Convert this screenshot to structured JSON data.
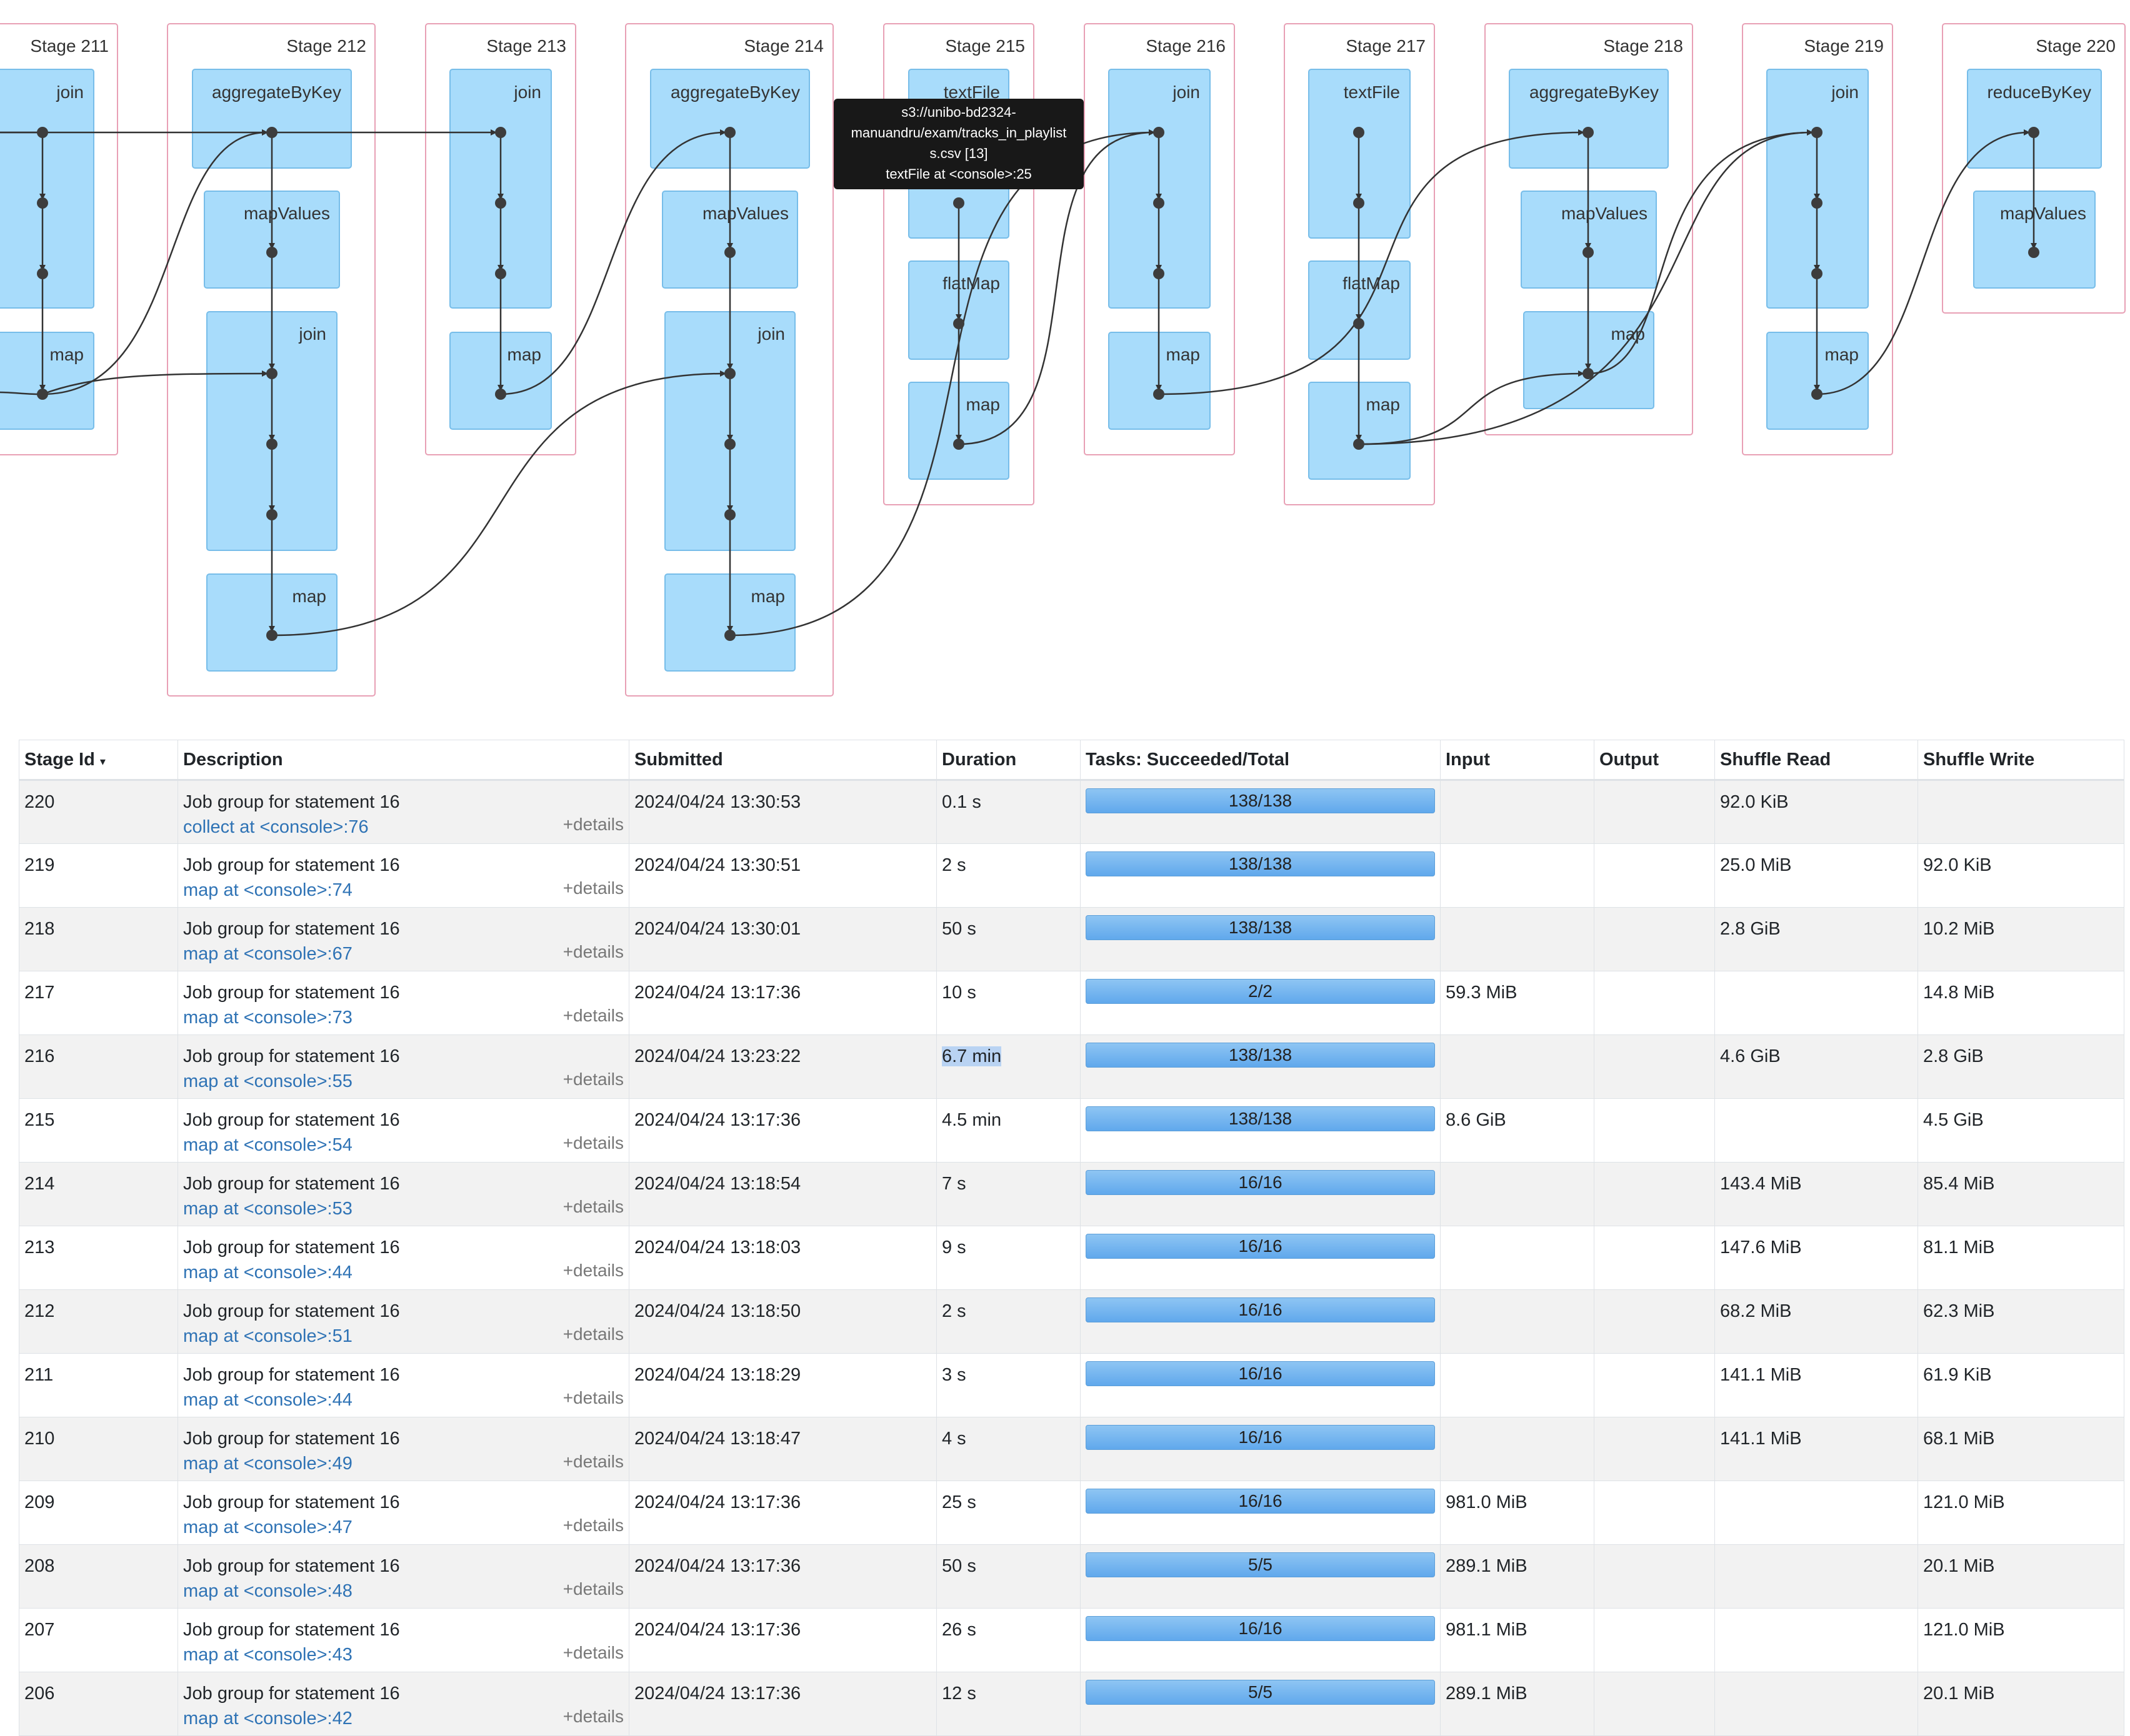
{
  "dag": {
    "stages": [
      {
        "title": "Stage 211",
        "ops": [
          "join",
          "map"
        ]
      },
      {
        "title": "Stage 212",
        "ops": [
          "aggregateByKey",
          "mapValues",
          "join",
          "map"
        ]
      },
      {
        "title": "Stage 213",
        "ops": [
          "join",
          "map"
        ]
      },
      {
        "title": "Stage 214",
        "ops": [
          "aggregateByKey",
          "mapValues",
          "join",
          "map"
        ]
      },
      {
        "title": "Stage 215",
        "ops": [
          "textFile",
          "flatMap",
          "map"
        ]
      },
      {
        "title": "Stage 216",
        "ops": [
          "join",
          "map"
        ]
      },
      {
        "title": "Stage 217",
        "ops": [
          "textFile",
          "flatMap",
          "map"
        ]
      },
      {
        "title": "Stage 218",
        "ops": [
          "aggregateByKey",
          "mapValues",
          "map"
        ]
      },
      {
        "title": "Stage 219",
        "ops": [
          "join",
          "map"
        ]
      },
      {
        "title": "Stage 220",
        "ops": [
          "reduceByKey",
          "mapValues"
        ]
      }
    ],
    "tooltip": {
      "lines": [
        "s3://unibo-bd2324-",
        "manuandru/exam/tracks_in_playlist",
        "s.csv [13]",
        "textFile at <console>:25"
      ]
    }
  },
  "table": {
    "headers": [
      "Stage Id",
      "Description",
      "Submitted",
      "Duration",
      "Tasks: Succeeded/Total",
      "Input",
      "Output",
      "Shuffle Read",
      "Shuffle Write"
    ],
    "sort_indicator": "▾",
    "details_label": "+details",
    "rows": [
      {
        "id": "220",
        "desc": "Job group for statement 16",
        "link": "collect at <console>:76",
        "submitted": "2024/04/24 13:30:53",
        "duration": "0.1 s",
        "tasks": "138/138",
        "input": "",
        "output": "",
        "shuffle_read": "92.0 KiB",
        "shuffle_write": ""
      },
      {
        "id": "219",
        "desc": "Job group for statement 16",
        "link": "map at <console>:74",
        "submitted": "2024/04/24 13:30:51",
        "duration": "2 s",
        "tasks": "138/138",
        "input": "",
        "output": "",
        "shuffle_read": "25.0 MiB",
        "shuffle_write": "92.0 KiB"
      },
      {
        "id": "218",
        "desc": "Job group for statement 16",
        "link": "map at <console>:67",
        "submitted": "2024/04/24 13:30:01",
        "duration": "50 s",
        "tasks": "138/138",
        "input": "",
        "output": "",
        "shuffle_read": "2.8 GiB",
        "shuffle_write": "10.2 MiB"
      },
      {
        "id": "217",
        "desc": "Job group for statement 16",
        "link": "map at <console>:73",
        "submitted": "2024/04/24 13:17:36",
        "duration": "10 s",
        "tasks": "2/2",
        "input": "59.3 MiB",
        "output": "",
        "shuffle_read": "",
        "shuffle_write": "14.8 MiB"
      },
      {
        "id": "216",
        "desc": "Job group for statement 16",
        "link": "map at <console>:55",
        "submitted": "2024/04/24 13:23:22",
        "duration": "6.7 min",
        "tasks": "138/138",
        "input": "",
        "output": "",
        "shuffle_read": "4.6 GiB",
        "shuffle_write": "2.8 GiB"
      },
      {
        "id": "215",
        "desc": "Job group for statement 16",
        "link": "map at <console>:54",
        "submitted": "2024/04/24 13:17:36",
        "duration": "4.5 min",
        "tasks": "138/138",
        "input": "8.6 GiB",
        "output": "",
        "shuffle_read": "",
        "shuffle_write": "4.5 GiB"
      },
      {
        "id": "214",
        "desc": "Job group for statement 16",
        "link": "map at <console>:53",
        "submitted": "2024/04/24 13:18:54",
        "duration": "7 s",
        "tasks": "16/16",
        "input": "",
        "output": "",
        "shuffle_read": "143.4 MiB",
        "shuffle_write": "85.4 MiB"
      },
      {
        "id": "213",
        "desc": "Job group for statement 16",
        "link": "map at <console>:44",
        "submitted": "2024/04/24 13:18:03",
        "duration": "9 s",
        "tasks": "16/16",
        "input": "",
        "output": "",
        "shuffle_read": "147.6 MiB",
        "shuffle_write": "81.1 MiB"
      },
      {
        "id": "212",
        "desc": "Job group for statement 16",
        "link": "map at <console>:51",
        "submitted": "2024/04/24 13:18:50",
        "duration": "2 s",
        "tasks": "16/16",
        "input": "",
        "output": "",
        "shuffle_read": "68.2 MiB",
        "shuffle_write": "62.3 MiB"
      },
      {
        "id": "211",
        "desc": "Job group for statement 16",
        "link": "map at <console>:44",
        "submitted": "2024/04/24 13:18:29",
        "duration": "3 s",
        "tasks": "16/16",
        "input": "",
        "output": "",
        "shuffle_read": "141.1 MiB",
        "shuffle_write": "61.9 KiB"
      },
      {
        "id": "210",
        "desc": "Job group for statement 16",
        "link": "map at <console>:49",
        "submitted": "2024/04/24 13:18:47",
        "duration": "4 s",
        "tasks": "16/16",
        "input": "",
        "output": "",
        "shuffle_read": "141.1 MiB",
        "shuffle_write": "68.1 MiB"
      },
      {
        "id": "209",
        "desc": "Job group for statement 16",
        "link": "map at <console>:47",
        "submitted": "2024/04/24 13:17:36",
        "duration": "25 s",
        "tasks": "16/16",
        "input": "981.0 MiB",
        "output": "",
        "shuffle_read": "",
        "shuffle_write": "121.0 MiB"
      },
      {
        "id": "208",
        "desc": "Job group for statement 16",
        "link": "map at <console>:48",
        "submitted": "2024/04/24 13:17:36",
        "duration": "50 s",
        "tasks": "5/5",
        "input": "289.1 MiB",
        "output": "",
        "shuffle_read": "",
        "shuffle_write": "20.1 MiB"
      },
      {
        "id": "207",
        "desc": "Job group for statement 16",
        "link": "map at <console>:43",
        "submitted": "2024/04/24 13:17:36",
        "duration": "26 s",
        "tasks": "16/16",
        "input": "981.1 MiB",
        "output": "",
        "shuffle_read": "",
        "shuffle_write": "121.0 MiB"
      },
      {
        "id": "206",
        "desc": "Job group for statement 16",
        "link": "map at <console>:42",
        "submitted": "2024/04/24 13:17:36",
        "duration": "12 s",
        "tasks": "5/5",
        "input": "289.1 MiB",
        "output": "",
        "shuffle_read": "",
        "shuffle_write": "20.1 MiB"
      }
    ]
  },
  "colors": {
    "stage_border": "#e8a0b5",
    "op_fill": "#a8dcfb",
    "op_border": "#77bde9",
    "link": "#2f73b5"
  }
}
